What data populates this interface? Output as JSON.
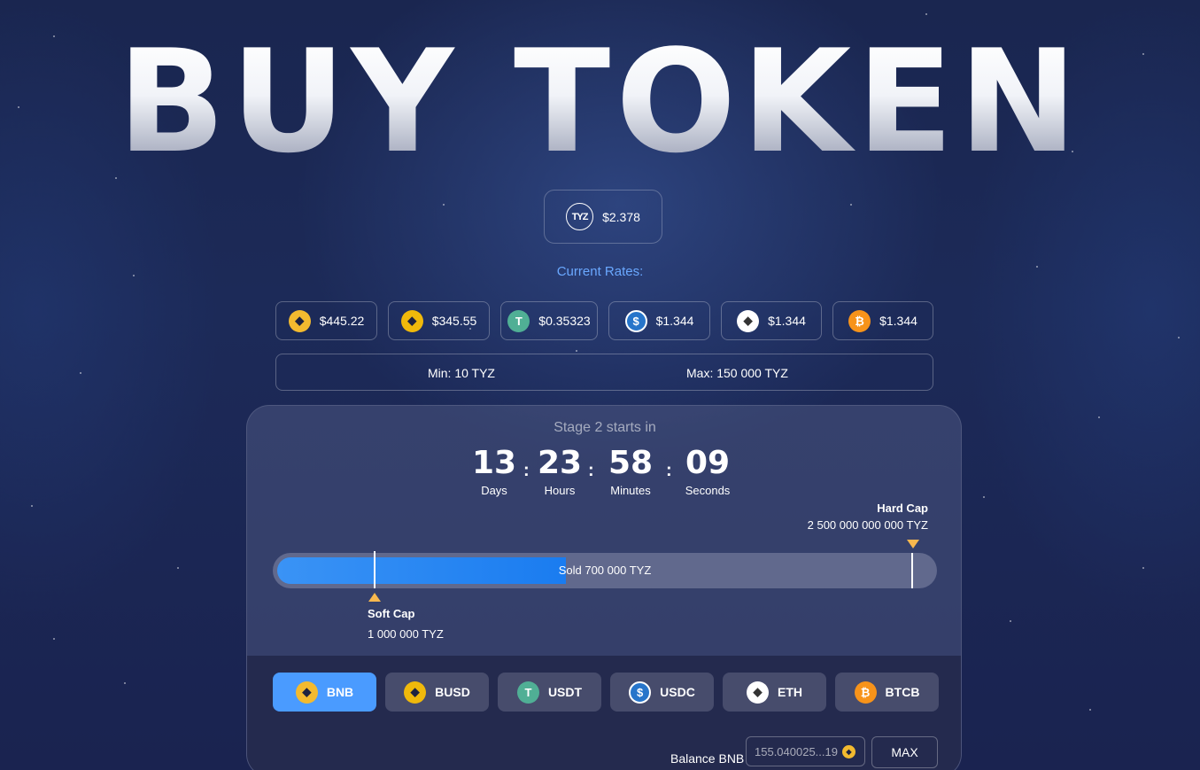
{
  "page": {
    "title": "BUY TOKEN"
  },
  "token": {
    "logo_text": "TYZ",
    "price": "$2.378"
  },
  "rates": {
    "label": "Current Rates:",
    "items": [
      {
        "icon": "bnb-icon",
        "value": "$445.22"
      },
      {
        "icon": "busd-icon",
        "value": "$345.55"
      },
      {
        "icon": "usdt-icon",
        "value": "$0.35323"
      },
      {
        "icon": "usdc-icon",
        "value": "$1.344"
      },
      {
        "icon": "eth-icon",
        "value": "$1.344"
      },
      {
        "icon": "btc-icon",
        "value": "$1.344"
      }
    ]
  },
  "limits": {
    "min": "Min: 10 TYZ",
    "max": "Max: 150 000 TYZ"
  },
  "stage": {
    "label": "Stage 2 starts in"
  },
  "countdown": {
    "days": "13",
    "days_label": "Days",
    "hours": "23",
    "hours_label": "Hours",
    "minutes": "58",
    "minutes_label": "Minutes",
    "seconds": "09",
    "seconds_label": "Seconds",
    "separator": ":"
  },
  "progress": {
    "hard_cap_label": "Hard Cap",
    "hard_cap_value": "2 500 000 000 000 TYZ",
    "soft_cap_label": "Soft Cap",
    "soft_cap_value": "1 000 000 TYZ",
    "sold_label": "Sold 700 000 TYZ",
    "fill_fraction": 0.44
  },
  "currency_tabs": [
    {
      "label": "BNB",
      "icon": "bnb-icon",
      "active": true
    },
    {
      "label": "BUSD",
      "icon": "busd-icon",
      "active": false
    },
    {
      "label": "USDT",
      "icon": "usdt-icon",
      "active": false
    },
    {
      "label": "USDC",
      "icon": "usdc-icon",
      "active": false
    },
    {
      "label": "ETH",
      "icon": "eth-icon",
      "active": false
    },
    {
      "label": "BTCB",
      "icon": "btc-icon",
      "active": false
    }
  ],
  "balance": {
    "label": "Balance BNB",
    "value": "155.040025...19",
    "max_label": "MAX"
  },
  "colors": {
    "accent": "#4a9bff",
    "rates_label": "#6aa8ff",
    "cap_marker": "#f8b84e",
    "progress_fill": "#1a7cf0"
  }
}
